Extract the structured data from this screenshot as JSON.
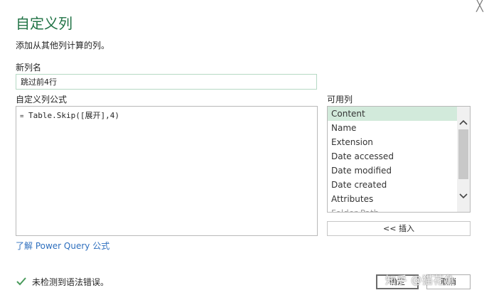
{
  "dialog": {
    "title": "自定义列",
    "subtitle": "添加从其他列计算的列。",
    "close_glyph": "╳"
  },
  "new_column": {
    "label": "新列名",
    "value": "跳过前4行"
  },
  "formula": {
    "label": "自定义列公式",
    "prefix": "=",
    "value": " Table.Skip([展开],4)"
  },
  "available_columns": {
    "label": "可用列",
    "items": [
      "Content",
      "Name",
      "Extension",
      "Date accessed",
      "Date modified",
      "Date created",
      "Attributes",
      "Folder Path"
    ],
    "selected": "Content",
    "insert_label": "<< 插入"
  },
  "learn_link": "了解 Power Query 公式",
  "status": {
    "icon": "check-icon",
    "text": "未检测到语法错误。"
  },
  "buttons": {
    "ok": "确定",
    "cancel": "取消"
  },
  "watermark": "知乎 @猫花鱼",
  "colors": {
    "title_green": "#217346",
    "selection": "#d2eadb",
    "link_blue": "#2e6fbe",
    "check_green": "#4a9b5c"
  }
}
